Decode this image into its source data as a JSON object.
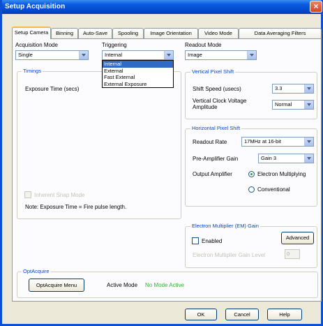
{
  "window": {
    "title": "Setup Acquisition"
  },
  "tabs": [
    {
      "label": "Setup Camera",
      "active": true
    },
    {
      "label": "Binning"
    },
    {
      "label": "Auto-Save"
    },
    {
      "label": "Spooling"
    },
    {
      "label": "Image Orientation"
    },
    {
      "label": "Video Mode"
    },
    {
      "label": "Data Averaging Filters"
    }
  ],
  "acquisition_mode": {
    "label": "Acquisition Mode",
    "value": "Single"
  },
  "triggering": {
    "label": "Triggering",
    "value": "Internal",
    "options": [
      "Internal",
      "External",
      "Fast External",
      "External Exposure"
    ],
    "selected_index": 0
  },
  "readout_mode": {
    "label": "Readout Mode",
    "value": "Image"
  },
  "timings": {
    "label": "Timings",
    "exposure_label": "Exposure Time (secs)",
    "kinetic_label": "Inherent Snap Mode",
    "note": "Note: Exposure Time = Fire pulse length."
  },
  "vertical_shift": {
    "label": "Vertical Pixel Shift",
    "shift_speed_label": "Shift Speed (usecs)",
    "shift_speed_value": "3.3",
    "clock_label_1": "Vertical Clock Voltage",
    "clock_label_2": "Amplitude",
    "clock_value": "Normal"
  },
  "horizontal_shift": {
    "label": "Horizontal Pixel Shift",
    "readout_rate_label": "Readout Rate",
    "readout_rate_value": "17MHz at 16-bit",
    "preamp_label": "Pre-Amplifier Gain",
    "preamp_value": "Gain 3",
    "output_amp_label": "Output Amplifier",
    "output_options": [
      "Electron Multiplying",
      "Conventional"
    ],
    "output_selected": 0
  },
  "em_gain": {
    "label": "Electron Multiplier (EM) Gain",
    "enabled_label": "Enabled",
    "advanced_label": "Advanced",
    "level_label": "Electron Multiplier Gain Level",
    "level_value": "0"
  },
  "optacquire": {
    "label": "OptAcquire",
    "button_label": "OptAcquire Menu",
    "active_mode_label": "Active Mode",
    "active_mode_value": "No Mode Active",
    "active_mode_color": "#3caa3c"
  },
  "footer": {
    "ok_label": "OK",
    "cancel_label": "Cancel",
    "help_label": "Help"
  },
  "colors": {
    "title_bar": "#0449cc",
    "group_label": "#0046d5",
    "selection": "#316ac5",
    "tab_highlight": "#f7b64b"
  }
}
